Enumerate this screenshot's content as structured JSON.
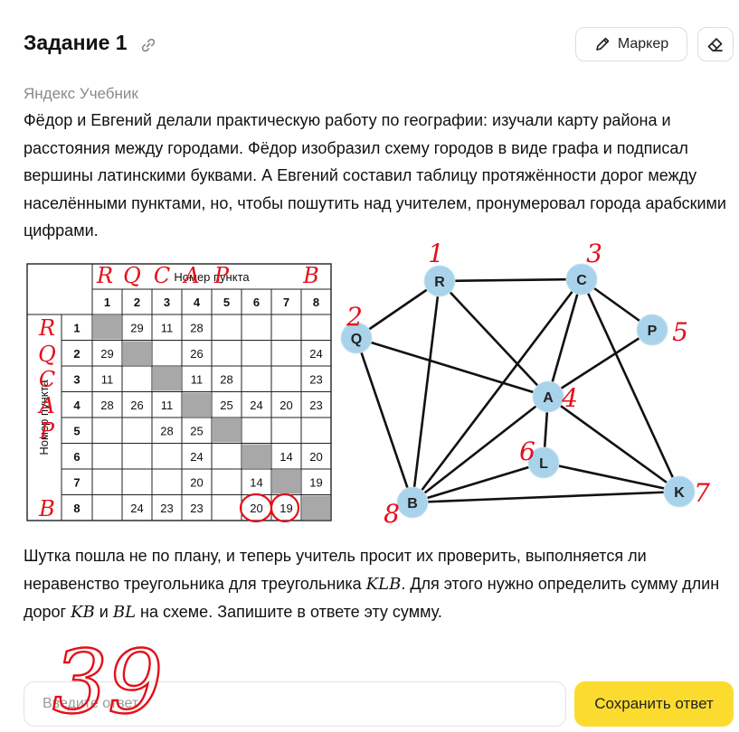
{
  "task": {
    "title": "Задание 1",
    "source": "Яндекс Учебник",
    "paragraph1": "Фёдор и Евгений делали практическую работу по географии: изучали карту района и расстояния между городами. Фёдор изобразил схему городов в виде графа и подписал вершины латинскими буквами. А Евгений составил таблицу протяжённости дорог между населёнными пунктами, но, чтобы пошутить над учителем, пронумеровал города арабскими цифрами.",
    "p2_before_klb": "Шутка пошла не по плану, и теперь учитель просит их проверить, выполняется ли неравенство треугольника для треугольника ",
    "klb": "KLB",
    "p2_after_klb": ". Для этого нужно определить сумму длин дорог ",
    "kb": "KB",
    "p2_and": " и ",
    "bl": "BL",
    "p2_end": " на схеме. Запишите в ответе эту сумму."
  },
  "toolbar": {
    "marker_label": "Маркер",
    "icons": [
      "link-icon",
      "pencil-icon",
      "eraser-icon"
    ]
  },
  "table": {
    "header_top": "Номер пункта",
    "header_side": "Номер пункта",
    "columns": [
      "1",
      "2",
      "3",
      "4",
      "5",
      "6",
      "7",
      "8"
    ],
    "rows": [
      {
        "label": "1",
        "cells": [
          "#",
          "29",
          "11",
          "28",
          "",
          "",
          "",
          ""
        ]
      },
      {
        "label": "2",
        "cells": [
          "29",
          "#",
          "",
          "26",
          "",
          "",
          "",
          "24"
        ]
      },
      {
        "label": "3",
        "cells": [
          "11",
          "",
          "#",
          "11",
          "28",
          "",
          "",
          "23"
        ]
      },
      {
        "label": "4",
        "cells": [
          "28",
          "26",
          "11",
          "#",
          "25",
          "24",
          "20",
          "23"
        ]
      },
      {
        "label": "5",
        "cells": [
          "",
          "",
          "28",
          "25",
          "#",
          "",
          "",
          ""
        ]
      },
      {
        "label": "6",
        "cells": [
          "",
          "",
          "",
          "24",
          "",
          "#",
          "14",
          "20"
        ]
      },
      {
        "label": "7",
        "cells": [
          "",
          "",
          "",
          "20",
          "",
          "14",
          "#",
          "19"
        ]
      },
      {
        "label": "8",
        "cells": [
          "",
          "24",
          "23",
          "23",
          "",
          "20",
          "19",
          "#"
        ]
      }
    ]
  },
  "graph": {
    "nodes": [
      "R",
      "C",
      "Q",
      "P",
      "A",
      "L",
      "B",
      "K"
    ],
    "edges": [
      [
        "R",
        "C"
      ],
      [
        "R",
        "Q"
      ],
      [
        "R",
        "A"
      ],
      [
        "R",
        "B"
      ],
      [
        "C",
        "P"
      ],
      [
        "C",
        "A"
      ],
      [
        "C",
        "B"
      ],
      [
        "C",
        "K"
      ],
      [
        "Q",
        "A"
      ],
      [
        "Q",
        "B"
      ],
      [
        "P",
        "A"
      ],
      [
        "A",
        "B"
      ],
      [
        "A",
        "L"
      ],
      [
        "A",
        "K"
      ],
      [
        "L",
        "B"
      ],
      [
        "L",
        "K"
      ],
      [
        "B",
        "K"
      ]
    ],
    "node_color": "#a9d3ea"
  },
  "annotations": {
    "column_letters": [
      "R",
      "Q",
      "C",
      "A",
      "P",
      "",
      "",
      "B"
    ],
    "row_letters": [
      "R",
      "Q",
      "C",
      "A",
      "P",
      "",
      "",
      "B"
    ],
    "node_numbers": {
      "R": "1",
      "C": "3",
      "Q": "2",
      "P": "5",
      "A": "4",
      "L": "6",
      "B": "8",
      "K": "7"
    },
    "circled_cells": [
      "20",
      "19"
    ],
    "answer_scribble": "39",
    "ink_color": "#e3101a"
  },
  "answer": {
    "placeholder": "Введите ответ",
    "save_label": "Сохранить ответ"
  },
  "colors": {
    "accent": "#fbdc2e",
    "gray_cell": "#a8a8a8",
    "source_text": "#8a8a8a"
  }
}
